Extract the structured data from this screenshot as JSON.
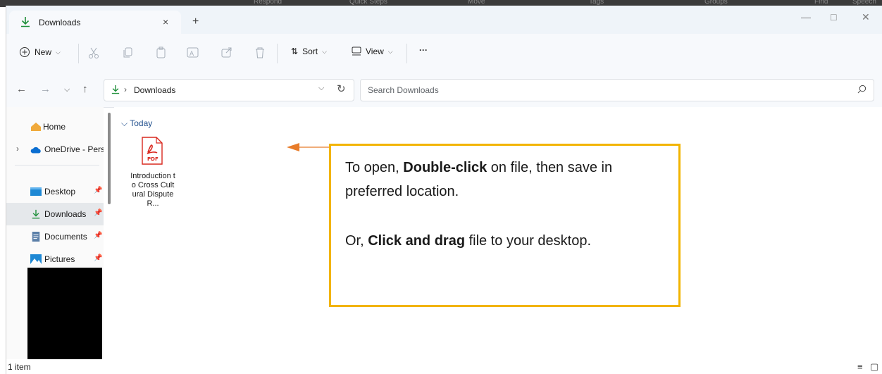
{
  "background_ribbon": [
    "Respond",
    "Quick Steps",
    "Move",
    "Tags",
    "Groups",
    "Find",
    "Speech"
  ],
  "tab": {
    "title": "Downloads",
    "close": "×",
    "new_tab": "+"
  },
  "window_controls": {
    "minimize": "—",
    "maximize": "□",
    "close": "✕"
  },
  "commands": {
    "new_label": "New",
    "sort_label": "Sort",
    "view_label": "View",
    "more": "···"
  },
  "address": {
    "crumb": "Downloads"
  },
  "search": {
    "placeholder": "Search Downloads"
  },
  "sidebar": {
    "items": [
      {
        "label": "Home"
      },
      {
        "label": "OneDrive - Perso"
      },
      {
        "label": "Desktop"
      },
      {
        "label": "Downloads"
      },
      {
        "label": "Documents"
      },
      {
        "label": "Pictures"
      }
    ]
  },
  "content": {
    "group": "Today",
    "file_name": "Introduction to Cross Cultural Dispute R...",
    "file_badge": "PDF"
  },
  "callout": {
    "p1_a": "To open, ",
    "p1_b": "Double-click",
    "p1_c": " on file, then save in preferred location.",
    "p2_a": "Or, ",
    "p2_b": "Click and drag",
    "p2_c": " file to your desktop."
  },
  "status": {
    "count": "1 item"
  },
  "colors": {
    "accent_download": "#1f8f3a",
    "callout_border": "#f2b400",
    "arrow": "#e87c2a",
    "pdf_red": "#d9281f"
  }
}
